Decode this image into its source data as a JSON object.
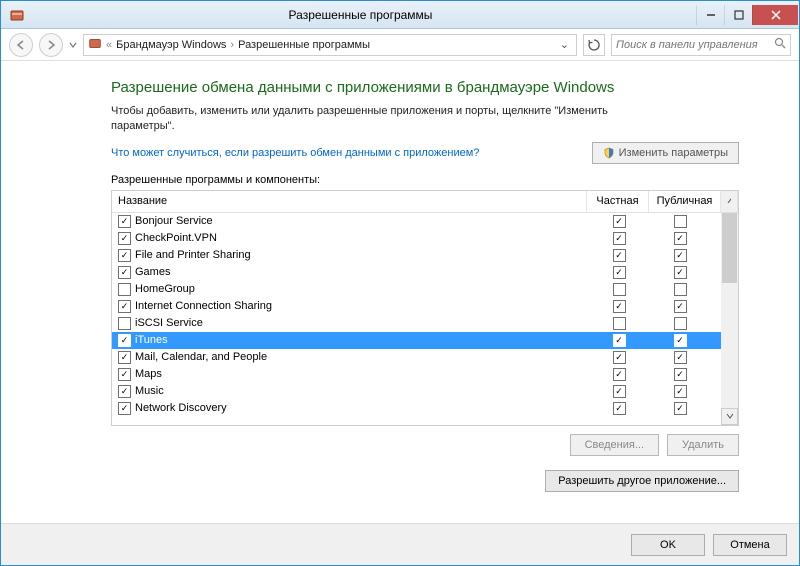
{
  "window": {
    "title": "Разрешенные программы"
  },
  "breadcrumb": {
    "prefix": "«",
    "item1": "Брандмауэр Windows",
    "item2": "Разрешенные программы"
  },
  "search": {
    "placeholder": "Поиск в панели управления"
  },
  "main": {
    "heading": "Разрешение обмена данными с приложениями в брандмауэре Windows",
    "description": "Чтобы добавить, изменить или удалить разрешенные приложения и порты, щелкните \"Изменить параметры\".",
    "help_link": "Что может случиться, если разрешить обмен данными с приложением?",
    "change_button": "Изменить параметры",
    "group_label": "Разрешенные программы и компоненты:",
    "columns": {
      "name": "Название",
      "private": "Частная",
      "public": "Публичная"
    },
    "rows": [
      {
        "name": "Bonjour Service",
        "enabled": true,
        "private": true,
        "public": false
      },
      {
        "name": "CheckPoint.VPN",
        "enabled": true,
        "private": true,
        "public": true
      },
      {
        "name": "File and Printer Sharing",
        "enabled": true,
        "private": true,
        "public": true
      },
      {
        "name": "Games",
        "enabled": true,
        "private": true,
        "public": true
      },
      {
        "name": "HomeGroup",
        "enabled": false,
        "private": false,
        "public": false
      },
      {
        "name": "Internet Connection Sharing",
        "enabled": true,
        "private": true,
        "public": true
      },
      {
        "name": "iSCSI Service",
        "enabled": false,
        "private": false,
        "public": false
      },
      {
        "name": "iTunes",
        "enabled": true,
        "private": true,
        "public": true,
        "selected": true
      },
      {
        "name": "Mail, Calendar, and People",
        "enabled": true,
        "private": true,
        "public": true
      },
      {
        "name": "Maps",
        "enabled": true,
        "private": true,
        "public": true
      },
      {
        "name": "Music",
        "enabled": true,
        "private": true,
        "public": true
      },
      {
        "name": "Network Discovery",
        "enabled": true,
        "private": true,
        "public": true
      }
    ],
    "details_button": "Сведения...",
    "remove_button": "Удалить",
    "allow_another": "Разрешить другое приложение..."
  },
  "footer": {
    "ok": "OK",
    "cancel": "Отмена"
  }
}
